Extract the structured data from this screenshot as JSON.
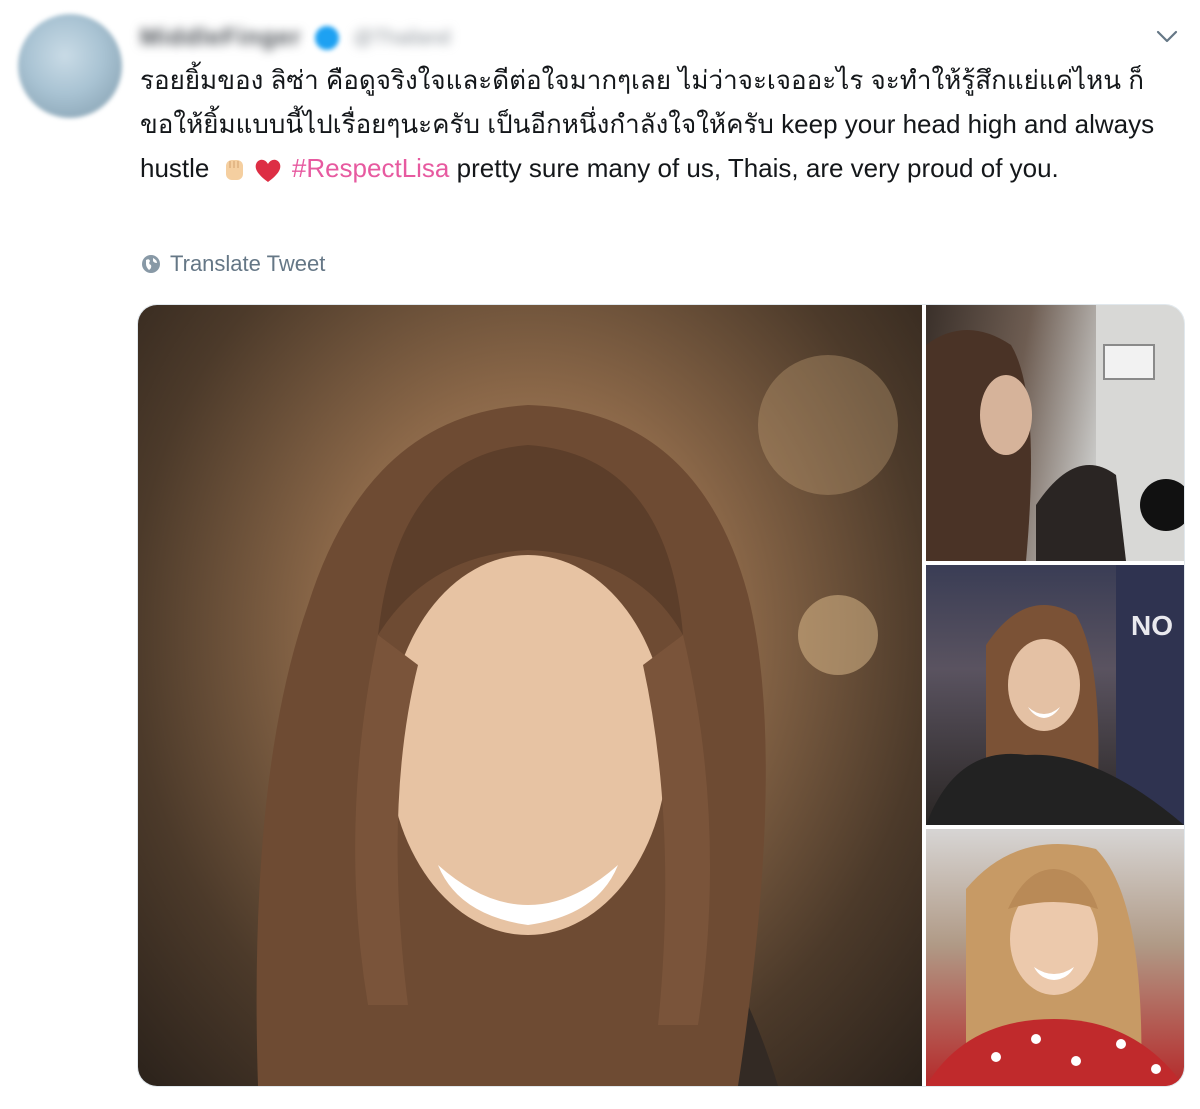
{
  "tweet": {
    "author": {
      "display_name": "MiddleFinger",
      "handle": "@Thailand",
      "avatar_icon": "avatar"
    },
    "text_thai": "รอยยิ้มของ ลิซ่า คือดูจริงใจและดีต่อใจมากๆเลย ไม่ว่าจะเจออะไร จะทำให้รู้สึกแย่แค่ไหน ก็ขอให้ยิ้มแบบนี้ไปเรื่อยๆนะครับ เป็นอีกหนึ่งกำลังใจให้ครับ",
    "text_english": "keep your head high and always hustle",
    "emojis": [
      "raised-fist-icon",
      "red-heart-icon"
    ],
    "hashtag": "#RespectLisa",
    "text_after_hashtag": "pretty sure many of us, Thais, are very proud of you.",
    "translate_label": "Translate Tweet",
    "colors": {
      "text": "#14171a",
      "hashtag": "#e75aa0",
      "secondary": "#657786",
      "verified": "#1da1f2"
    }
  },
  "media": {
    "photo_count": 4,
    "signs": {
      "photo_2_sign": "NO"
    }
  }
}
